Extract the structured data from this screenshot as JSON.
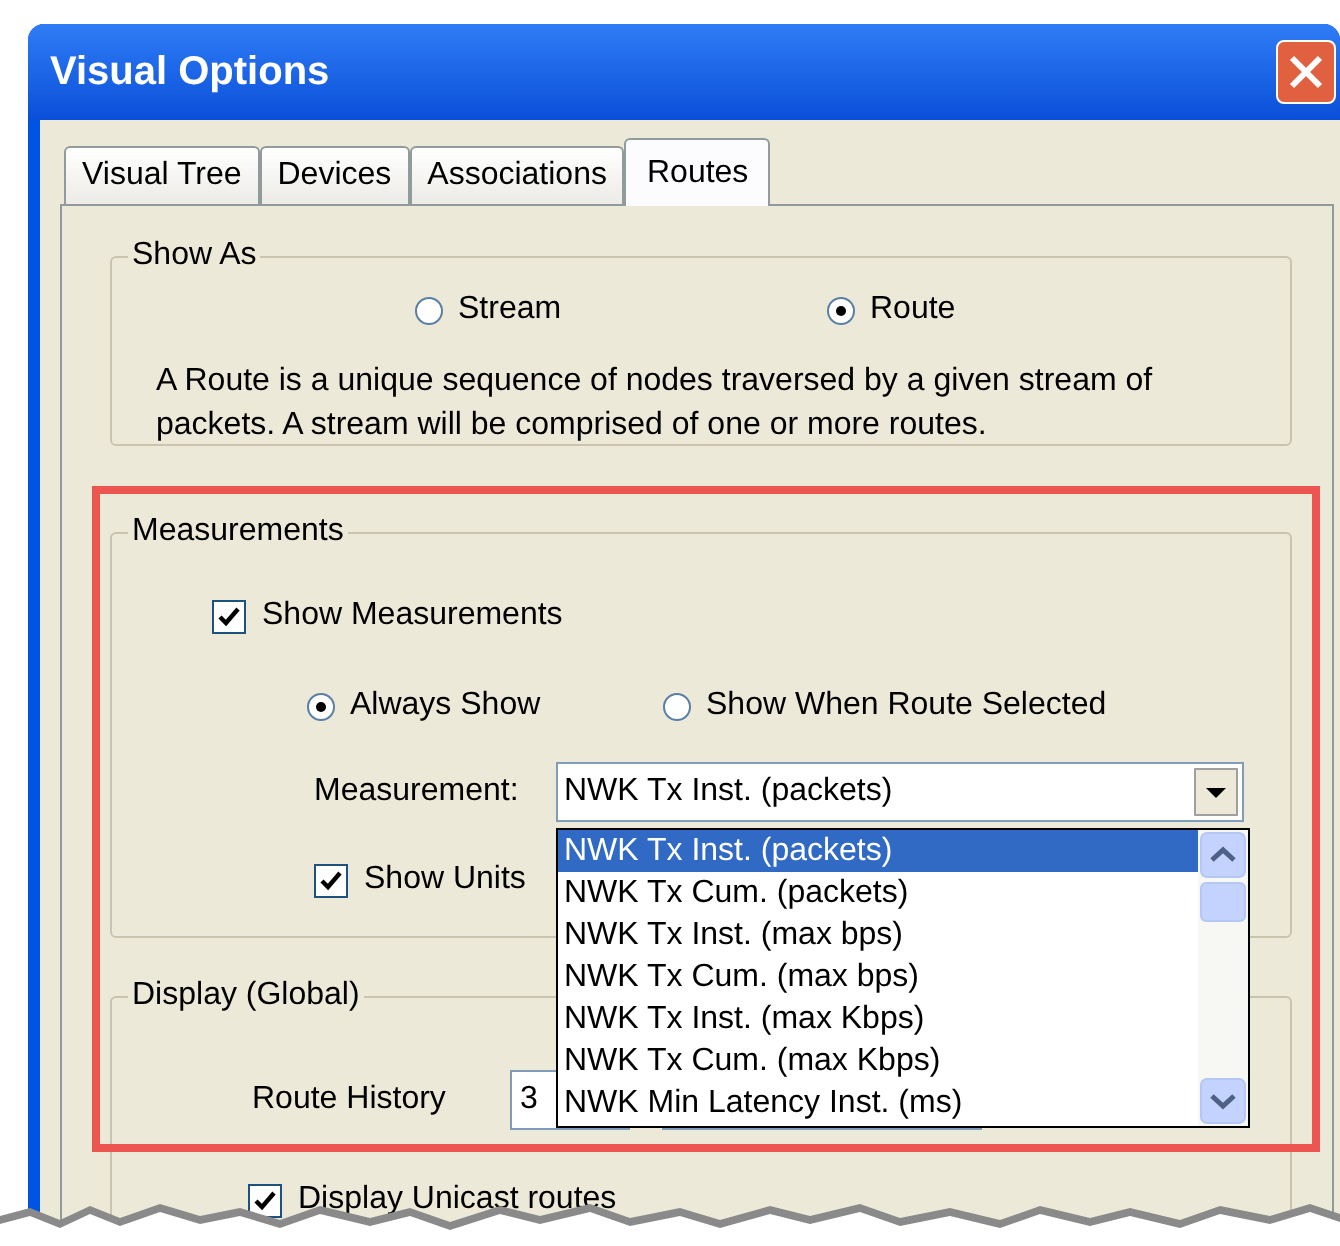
{
  "window": {
    "title": "Visual Options"
  },
  "tabs": [
    {
      "label": "Visual Tree",
      "selected": false
    },
    {
      "label": "Devices",
      "selected": false
    },
    {
      "label": "Associations",
      "selected": false
    },
    {
      "label": "Routes",
      "selected": true
    }
  ],
  "show_as": {
    "title": "Show As",
    "options": [
      {
        "label": "Stream",
        "selected": false
      },
      {
        "label": "Route",
        "selected": true
      }
    ],
    "description": "A Route is a unique sequence of nodes traversed by a given stream of packets. A stream will be comprised of one or more routes."
  },
  "measurements": {
    "title": "Measurements",
    "show_measurements": {
      "label": "Show Measurements",
      "checked": true
    },
    "options": [
      {
        "label": "Always Show",
        "selected": true
      },
      {
        "label": "Show When Route Selected",
        "selected": false
      }
    ],
    "measurement": {
      "label": "Measurement:",
      "value": "NWK Tx Inst. (packets)",
      "expanded": true,
      "items": [
        {
          "label": "NWK Tx Inst. (packets)",
          "selected": true
        },
        {
          "label": "NWK Tx Cum. (packets)",
          "selected": false
        },
        {
          "label": "NWK Tx Inst. (max bps)",
          "selected": false
        },
        {
          "label": "NWK Tx Cum. (max bps)",
          "selected": false
        },
        {
          "label": "NWK Tx Inst. (max Kbps)",
          "selected": false
        },
        {
          "label": "NWK Tx Cum. (max Kbps)",
          "selected": false
        },
        {
          "label": "NWK Min Latency Inst. (ms)",
          "selected": false
        }
      ]
    },
    "show_units": {
      "label": "Show Units",
      "checked": true
    }
  },
  "display": {
    "title": "Display (Global)",
    "route_history": {
      "label": "Route History",
      "value": "3"
    },
    "display_unicast": {
      "label": "Display Unicast routes",
      "checked": true
    }
  }
}
